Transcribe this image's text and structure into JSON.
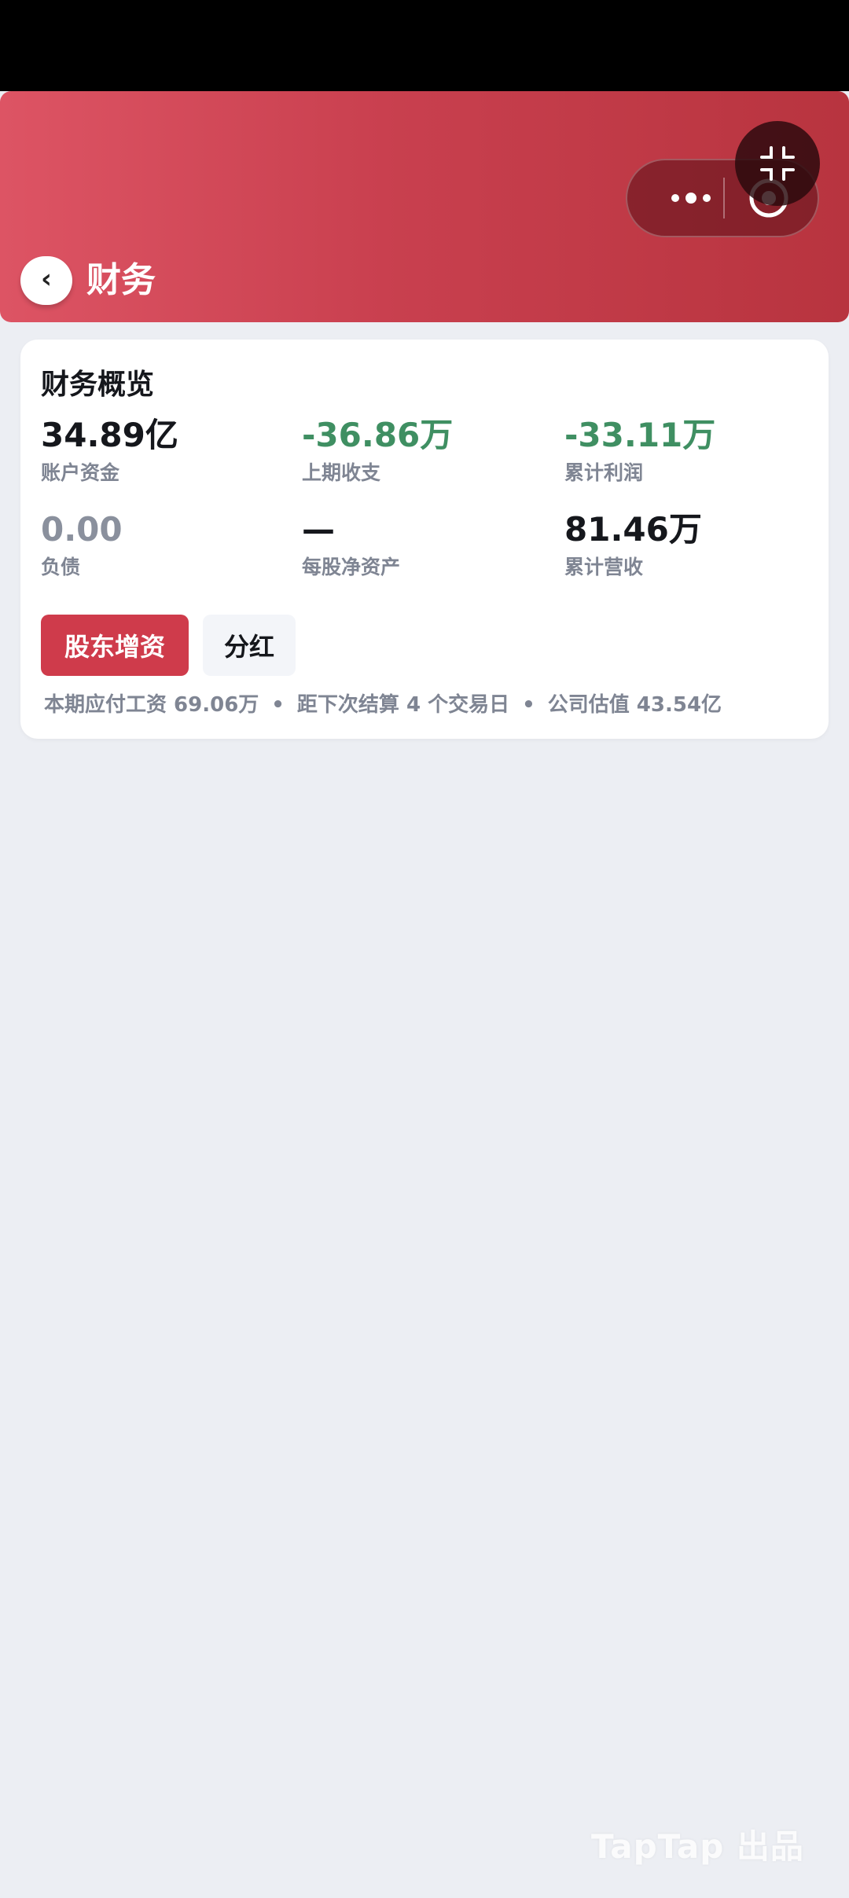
{
  "header": {
    "title": "财务",
    "back_icon": "chevron-left-icon"
  },
  "capsule": {
    "more_icon": "more-dots-icon",
    "target_icon": "target-icon"
  },
  "float_button": {
    "icon": "collapse-icon"
  },
  "overview": {
    "title": "财务概览",
    "stats": [
      {
        "value": "34.89亿",
        "label": "账户资金"
      },
      {
        "value": "-36.86万",
        "label": "上期收支"
      },
      {
        "value": "-33.11万",
        "label": "累计利润"
      },
      {
        "value": "0.00",
        "label": "负债"
      },
      {
        "value": "—",
        "label": "每股净资产"
      },
      {
        "value": "81.46万",
        "label": "累计营收"
      }
    ],
    "actions": {
      "increase_capital": "股东增资",
      "dividend": "分红"
    },
    "footer": {
      "payroll": "本期应付工资 69.06万",
      "next_settlement": "距下次结算 4 个交易日",
      "valuation": "公司估值 43.54亿",
      "separator": "•"
    }
  },
  "colors": {
    "header_start": "#dd5464",
    "header_end": "#b8343f",
    "negative_green": "#3f8f62",
    "primary_button": "#cf3b4b"
  },
  "watermark": "TapTap 出品"
}
